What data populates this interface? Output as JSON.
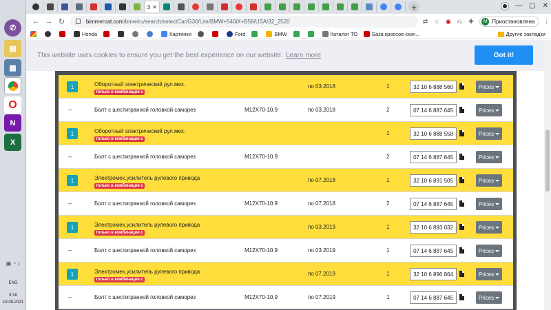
{
  "taskbar": {
    "icons": [
      "viber-icon",
      "explorer-icon",
      "network-icon",
      "chrome-icon",
      "opera-icon",
      "onenote-icon",
      "excel-icon"
    ],
    "lang": "ENG",
    "time": "9:18",
    "date": "19.08.2021"
  },
  "browser": {
    "active_tab_label": "З",
    "url_host": "bimmercat.com",
    "url_path": "/bmw/ru/search/selectCar/G30/Lim/BMW+540iX+B58/USA/32_2520",
    "profile_initial": "M",
    "profile_label": "Приостановлена",
    "bookmarks": [
      "Honda",
      "Картинки",
      "Ford",
      "BMW",
      "Каталог ТО",
      "База кроссов скач..."
    ],
    "bookmarks_other": "Другие закладки"
  },
  "cookie": {
    "text": "This website uses cookies to ensure you get the best experience on our website.",
    "learn_more": "Learn more",
    "button": "Got it!"
  },
  "parts": {
    "badge_text": "только в комбинации с",
    "prices_label": "Prices",
    "rows": [
      {
        "type": "hl",
        "qty_box": "1",
        "name": "Оборотный электрический рул.мех.",
        "spec": "",
        "date": "по 03.2018",
        "qty": "1",
        "part_no": "32 10 6 888 560"
      },
      {
        "type": "pl",
        "qty_box": "--",
        "name": "Болт с шестигранной головкой саморез",
        "spec": "M12X70-10.9",
        "date": "по 03.2018",
        "qty": "2",
        "part_no": "07 14 6 887 645"
      },
      {
        "type": "hl",
        "qty_box": "1",
        "name": "Оборотный электрический рул.мех.",
        "spec": "",
        "date": "",
        "qty": "1",
        "part_no": "32 10 6 888 558"
      },
      {
        "type": "pl",
        "qty_box": "--",
        "name": "Болт с шестигранной головкой саморез",
        "spec": "M12X70-10.9",
        "date": "",
        "qty": "2",
        "part_no": "07 14 6 887 645"
      },
      {
        "type": "hl",
        "qty_box": "1",
        "name": "Электромех.усилитель рулевого привода",
        "spec": "",
        "date": "по 07.2018",
        "qty": "1",
        "part_no": "32 10 6 891 505"
      },
      {
        "type": "pl",
        "qty_box": "--",
        "name": "Болт с шестигранной головкой саморез",
        "spec": "M12X70-10.9",
        "date": "по 07.2018",
        "qty": "2",
        "part_no": "07 14 6 887 645"
      },
      {
        "type": "hl",
        "qty_box": "1",
        "name": "Электромех.усилитель рулевого привода",
        "spec": "",
        "date": "по 03.2019",
        "qty": "1",
        "part_no": "32 10 6 893 032"
      },
      {
        "type": "pl",
        "qty_box": "--",
        "name": "Болт с шестигранной головкой саморез",
        "spec": "M12X70-10.9",
        "date": "по 03.2019",
        "qty": "1",
        "part_no": "07 14 6 887 645"
      },
      {
        "type": "hl",
        "qty_box": "1",
        "name": "Электромех.усилитель рулевого привода",
        "spec": "",
        "date": "по 07.2019",
        "qty": "1",
        "part_no": "32 10 6 896 864"
      },
      {
        "type": "pl",
        "qty_box": "--",
        "name": "Болт с шестигранной головкой саморез",
        "spec": "M12X70-10.9",
        "date": "по 07.2019",
        "qty": "1",
        "part_no": "07 14 6 887 645"
      }
    ]
  },
  "colors": {
    "highlight_row": "#ffde3b",
    "qty_box": "#17a2b8",
    "badge": "#dc3545",
    "prices_button": "#6c757d",
    "got_it": "#1f8ff5"
  }
}
